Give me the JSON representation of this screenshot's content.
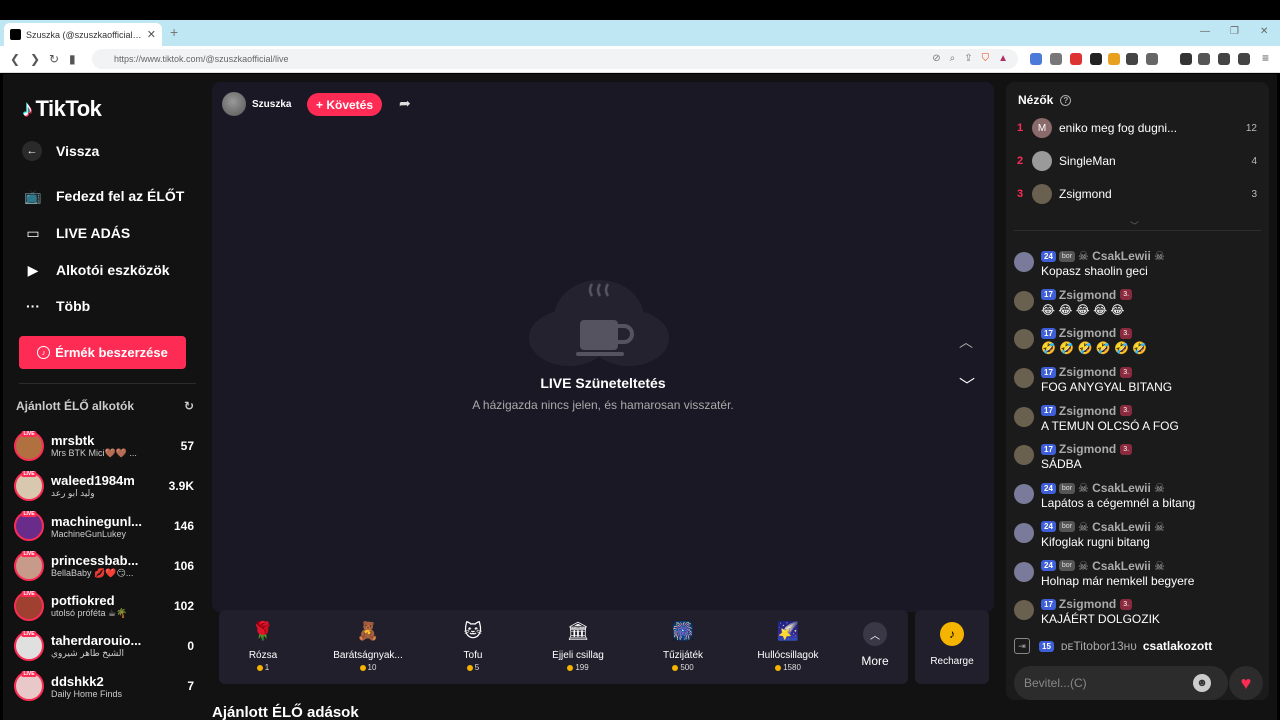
{
  "browser": {
    "tab_title": "Szuszka (@szuszkaofficial) ÉLŐ a...",
    "url": "https://www.tiktok.com/@szuszkaofficial/live"
  },
  "sidebar": {
    "brand": "TikTok",
    "back": "Vissza",
    "nav": [
      {
        "label": "Fedezd fel az ÉLŐT",
        "icon": "live-tv-icon"
      },
      {
        "label": "LIVE ADÁS",
        "icon": "camera-icon"
      },
      {
        "label": "Alkotói eszközök",
        "icon": "creator-tools-icon"
      },
      {
        "label": "Több",
        "icon": "more-dots-icon"
      }
    ],
    "coins_button": "Érmék beszerzése",
    "recommended_title": "Ajánlott ÉLŐ alkotók",
    "live_badge": "LIVE",
    "recommended": [
      {
        "name": "mrsbtk",
        "sub": "Mrs BTK Mici🤎🤎 ...",
        "count": "57",
        "color": "#b07040"
      },
      {
        "name": "waleed1984m",
        "sub": "وليد ابو رعد",
        "count": "3.9K",
        "color": "#d8c8b0"
      },
      {
        "name": "machinegunl...",
        "sub": "MachineGunLukey",
        "count": "146",
        "color": "#6a2c8a"
      },
      {
        "name": "princessbab...",
        "sub": "BellaBaby 💋❤️😏...",
        "count": "106",
        "color": "#c89a8a"
      },
      {
        "name": "potfiokred",
        "sub": "utolsó próféta ☕🌴",
        "count": "102",
        "color": "#a04030"
      },
      {
        "name": "taherdarouio...",
        "sub": "الشيخ طاهر شيروي",
        "count": "0",
        "color": "#e0e0e0"
      },
      {
        "name": "ddshkk2",
        "sub": "Daily Home Finds",
        "count": "7",
        "color": "#e8c8c8"
      }
    ]
  },
  "stage": {
    "host_name": "Szuszka",
    "follow_label": "+ Követés",
    "pause_title": "LIVE Szüneteltetés",
    "pause_subtitle": "A házigazda nincs jelen, és hamarosan visszatér."
  },
  "gifts": [
    {
      "name": "Rózsa",
      "price": "1",
      "emoji": "🌹"
    },
    {
      "name": "Barátságnyak...",
      "price": "10",
      "emoji": "🧸"
    },
    {
      "name": "Tofu",
      "price": "5",
      "emoji": "🐱"
    },
    {
      "name": "Éjjeli csillag",
      "price": "199",
      "emoji": "🏛"
    },
    {
      "name": "Tűzijáték",
      "price": "500",
      "emoji": "🎆"
    },
    {
      "name": "Hullócsillagok",
      "price": "1580",
      "emoji": "🌠"
    }
  ],
  "gifts_more": "More",
  "recharge": "Recharge",
  "section_below": "Ajánlott ÉLŐ adások",
  "chat": {
    "viewers_title": "Nézők",
    "viewers": [
      {
        "rank": "1",
        "name": "eniko meg fog dugni...",
        "score": "12",
        "initial": "M"
      },
      {
        "rank": "2",
        "name": "SingleMan",
        "score": "4",
        "initial": ""
      },
      {
        "rank": "3",
        "name": "Zsigmond",
        "score": "3",
        "initial": ""
      }
    ],
    "messages": [
      {
        "level": "24",
        "fan": "bor",
        "user": "☠ CsakLewii ☠",
        "rank": "",
        "text": "Kopasz shaolin geci"
      },
      {
        "level": "17",
        "fan": "",
        "user": "Zsigmond",
        "rank": "3.",
        "text": "😂 😂 😂 😂 😂"
      },
      {
        "level": "17",
        "fan": "",
        "user": "Zsigmond",
        "rank": "3.",
        "text": "🤣 🤣 🤣 🤣 🤣 🤣"
      },
      {
        "level": "17",
        "fan": "",
        "user": "Zsigmond",
        "rank": "3.",
        "text": "FOG ANYGYAL BITANG"
      },
      {
        "level": "17",
        "fan": "",
        "user": "Zsigmond",
        "rank": "3.",
        "text": "A TEMUN OLCSÓ A FOG"
      },
      {
        "level": "17",
        "fan": "",
        "user": "Zsigmond",
        "rank": "3.",
        "text": "SÁDBA"
      },
      {
        "level": "24",
        "fan": "bor",
        "user": "☠ CsakLewii ☠",
        "rank": "",
        "text": "Lapátos a cégemnél a bitang"
      },
      {
        "level": "24",
        "fan": "bor",
        "user": "☠ CsakLewii ☠",
        "rank": "",
        "text": "Kifoglak rugni bitang"
      },
      {
        "level": "24",
        "fan": "bor",
        "user": "☠ CsakLewii ☠",
        "rank": "",
        "text": "Holnap már nemkell begyere"
      },
      {
        "level": "17",
        "fan": "",
        "user": "Zsigmond",
        "rank": "3.",
        "text": "KAJÁÉRT DOLGOZIK"
      }
    ],
    "join": {
      "level": "15",
      "user": "ᴅᴇTitobor13ʜᴜ",
      "action": "csatlakozott"
    },
    "input_placeholder": "Bevitel...(C)"
  }
}
